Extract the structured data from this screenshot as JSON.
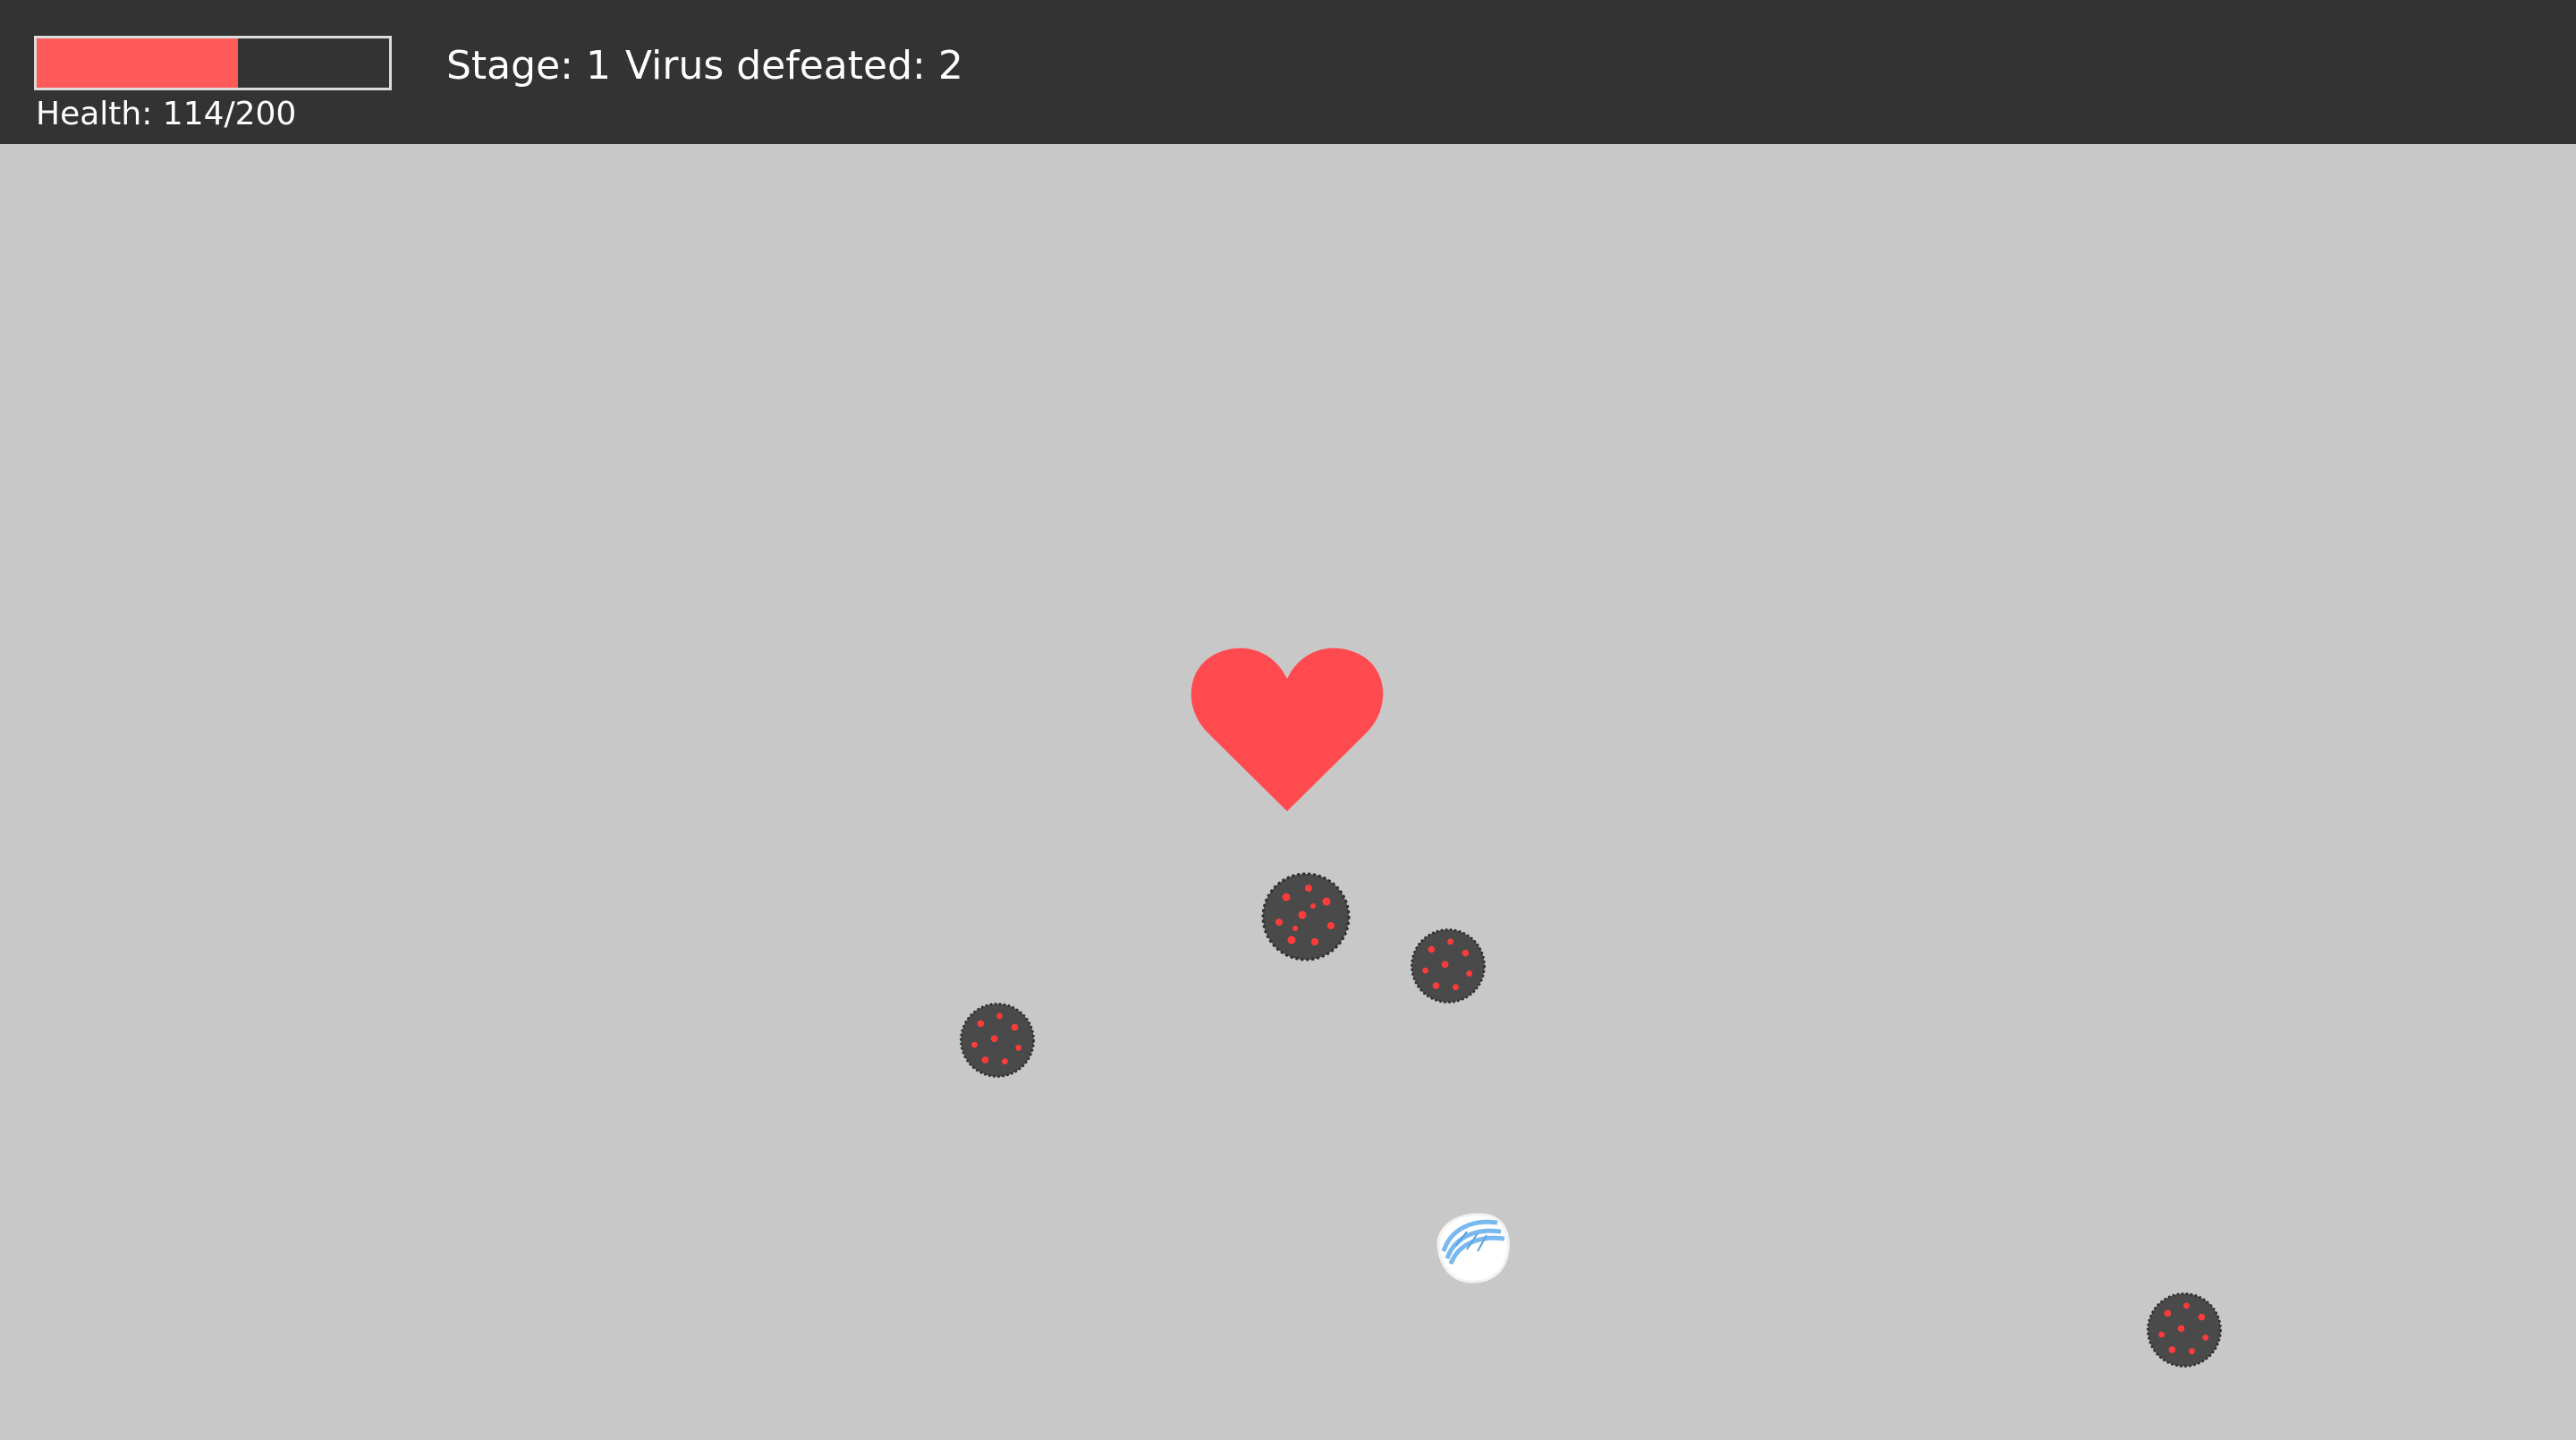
{
  "hud": {
    "health_label": "Health: 114/200",
    "health_current": 114,
    "health_max": 200,
    "stage_label": "Stage: 1",
    "defeated_label": "Virus defeated: 2"
  },
  "colors": {
    "hud_background": "#333333",
    "health_fill": "#ff5a5a",
    "playfield_background": "#c8c8c8",
    "heart": "#ff4a4f",
    "virus_body": "#4a4a4a",
    "virus_spots": "#ff3b3b",
    "mask_stripes": "#7ab8f0"
  },
  "sprites": {
    "heart": "heart-icon",
    "virus": "virus-icon",
    "mask": "face-mask-icon"
  }
}
